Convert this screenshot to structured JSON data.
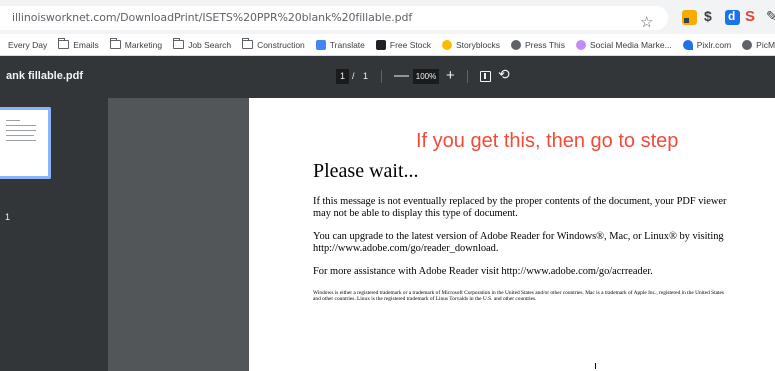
{
  "browser": {
    "url": "illinoisworknet.com/DownloadPrint/ISETS%20PPR%20blank%20fillable.pdf",
    "star_icon": "star-icon",
    "extensions": [
      "extension-1-icon",
      "extension-2-icon",
      "extension-3-icon",
      "extension-4-icon",
      "extension-5-icon"
    ]
  },
  "bookmarks": [
    {
      "label": "Every Day",
      "icon": "none"
    },
    {
      "label": "Emails",
      "icon": "folder-icon"
    },
    {
      "label": "Marketing",
      "icon": "folder-icon"
    },
    {
      "label": "Job Search",
      "icon": "folder-icon"
    },
    {
      "label": "Construction",
      "icon": "folder-icon"
    },
    {
      "label": "Translate",
      "icon": "translate-icon"
    },
    {
      "label": "Free Stock",
      "icon": "freestock-icon"
    },
    {
      "label": "Storyblocks",
      "icon": "storyblocks-icon"
    },
    {
      "label": "Press This",
      "icon": "press-icon"
    },
    {
      "label": "Social Media Marke...",
      "icon": "social-icon"
    },
    {
      "label": "Pixlr.com",
      "icon": "pixlr-icon"
    },
    {
      "label": "PicMark",
      "icon": "picmark-icon"
    }
  ],
  "pdf_toolbar": {
    "title": "ank fillable.pdf",
    "page_current": "1",
    "page_separator": "/",
    "page_total": "1",
    "zoom_minus": "—",
    "zoom": "100%",
    "zoom_plus": "+"
  },
  "sidebar": {
    "thumbnail_page_number": "1"
  },
  "document": {
    "overlay_note": "If you get this, then go to step",
    "heading": "Please wait...",
    "paragraphs": [
      "If this message is not eventually replaced by the proper contents of the document, your PDF viewer may not be able to display this type of document.",
      "You can upgrade to the latest version of Adobe Reader for Windows®, Mac, or Linux® by visiting  http://www.adobe.com/go/reader_download.",
      "For more assistance with Adobe Reader visit  http://www.adobe.com/go/acrreader."
    ],
    "fine_print": "Windows is either a registered trademark or a trademark of Microsoft Corporation in the United States and/or other countries. Mac is a trademark of Apple Inc., registered in the United States and other countries. Linux is the registered trademark of Linus Torvalds in the U.S. and other countries."
  },
  "colors": {
    "toolbar": "#323639",
    "viewer_background": "#525659",
    "thumbnail_selection": "#8ab4f8",
    "overlay_note": "#f24b3a"
  }
}
